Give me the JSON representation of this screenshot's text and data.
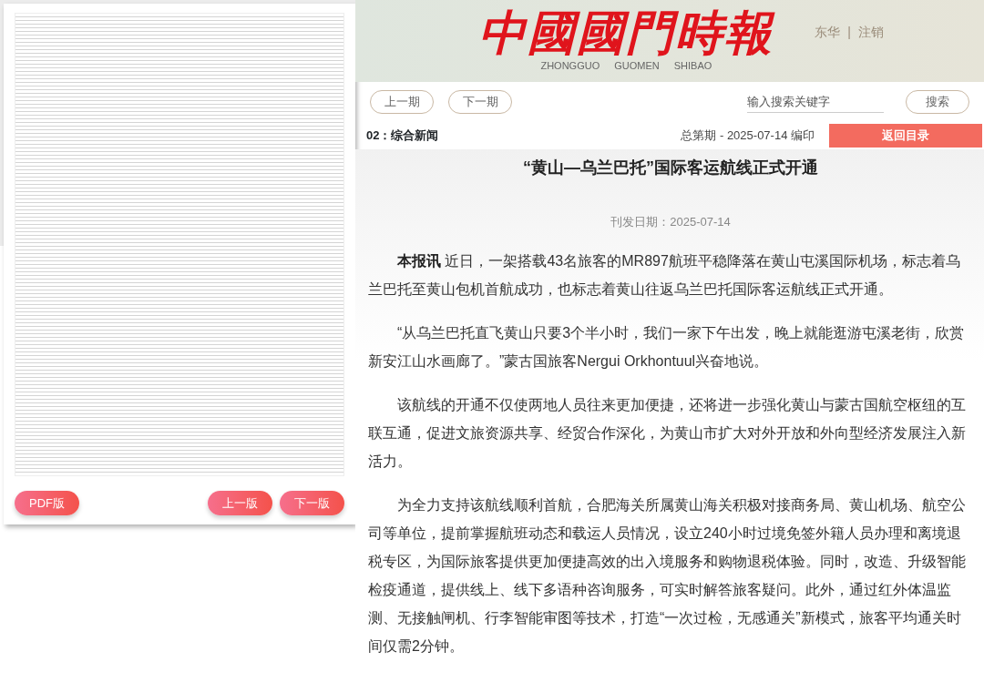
{
  "page_viewer": {
    "buttons": [
      {
        "label": "PDF版",
        "kind": "pdf"
      },
      {
        "label": "上一版",
        "kind": "prev"
      },
      {
        "label": "下一版",
        "kind": "next"
      }
    ]
  },
  "header": {
    "logo": "中國國門時報",
    "logo_pinyin": [
      "ZHONGGUO",
      "GUOMEN",
      "SHIBAO"
    ],
    "user": "东华",
    "separator": "|",
    "logout": "注销"
  },
  "nav": {
    "buttons": [
      "上一期",
      "下一期"
    ],
    "search": {
      "placeholder": "输入搜索关键字"
    },
    "search_button": "搜索"
  },
  "edition": {
    "section": "02：综合新闻",
    "issue": "总第期 - 2025-07-14 编印",
    "back_button": "返回目录"
  },
  "article": {
    "title": "“黄山—乌兰巴托”国际客运航线正式开通",
    "date": "刊发日期：2025-07-14",
    "paragraphs": [
      "**本报讯** 近日，一架搭载43名旅客的MR897航班平稳降落在黄山屯溪国际机场，标志着乌兰巴托至黄山包机首航成功，也标志着黄山往返乌兰巴托国际客运航线正式开通。",
      "“从乌兰巴托直飞黄山只要3个半小时，我们一家下午出发，晚上就能逛游屯溪老街，欣赏新安江山水画廊了。”蒙古国旅客Nergui Orkhontuul兴奋地说。",
      "该航线的开通不仅使两地人员往来更加便捷，还将进一步强化黄山与蒙古国航空枢纽的互联互通，促进文旅资源共享、经贸合作深化，为黄山市扩大对外开放和外向型经济发展注入新活力。",
      "为全力支持该航线顺利首航，合肥海关所属黄山海关积极对接商务局、黄山机场、航空公司等单位，提前掌握航班动态和载运人员情况，设立240小时过境免签外籍人员办理和离境退税专区，为国际旅客提供更加便捷高效的出入境服务和购物退税体验。同时，改造、升级智能检疫通道，提供线上、线下多语种咨询服务，可实时解答旅客疑问。此外，通过红外体温监测、无接触闸机、行李智能审图等技术，打造“一次过检，无感通关”新模式，旅客平均通关时间仅需2分钟。"
    ]
  }
}
